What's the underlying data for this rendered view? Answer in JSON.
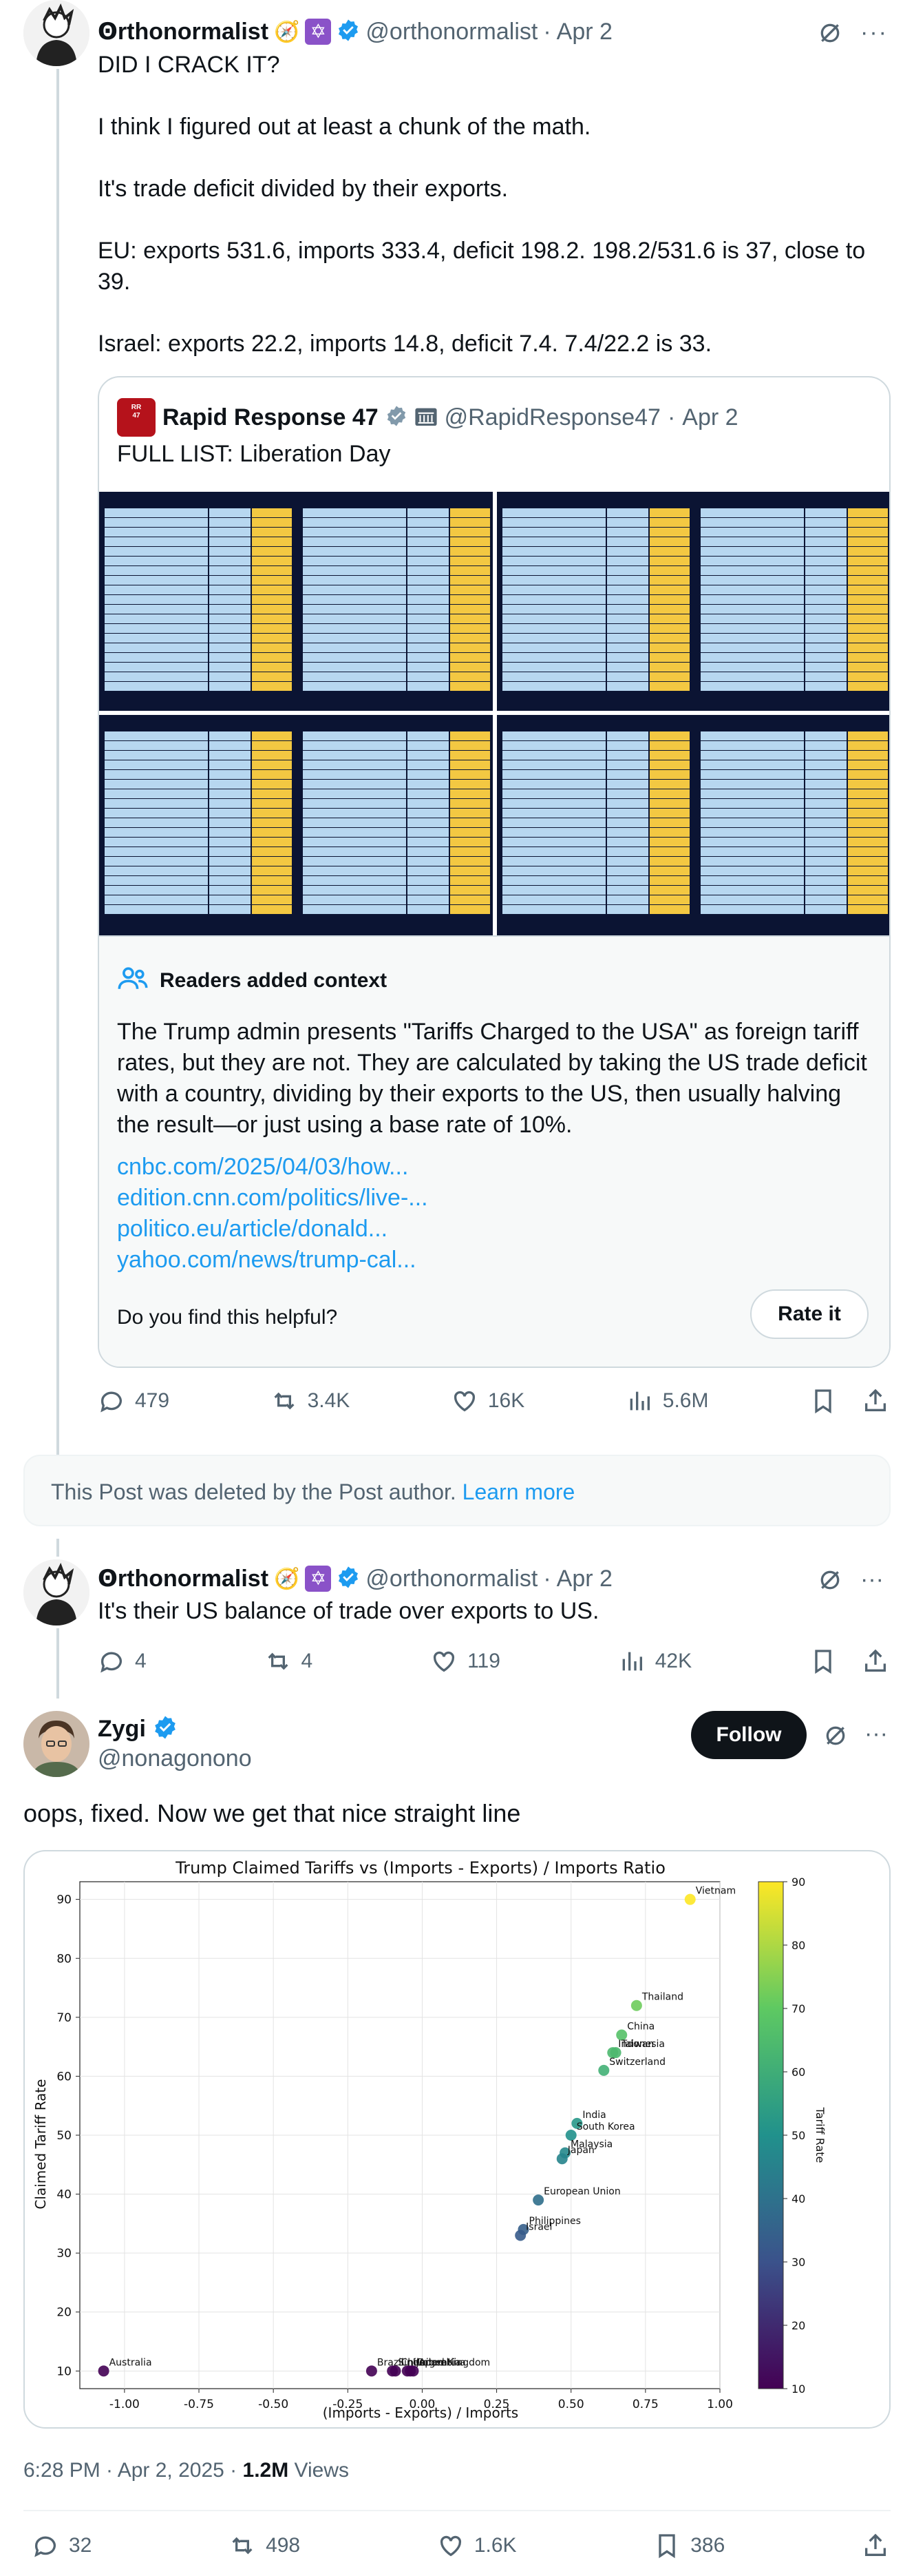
{
  "tweet1": {
    "display_name": "Ꙩrthonormalist",
    "handle": "@orthonormalist",
    "date": "Apr 2",
    "body": "DID I CRACK IT?\n\nI think I figured out at least a chunk of the math.\n\nIt's trade deficit divided by their exports.\n\nEU: exports 531.6, imports 333.4, deficit 198.2. 198.2/531.6 is 37, close to 39.\n\nIsrael: exports 22.2, imports 14.8, deficit 7.4. 7.4/22.2 is 33.",
    "quote": {
      "display_name": "Rapid Response 47",
      "handle": "@RapidResponse47",
      "date": "Apr 2",
      "text": "FULL LIST: Liberation Day"
    },
    "community_note": {
      "title": "Readers added context",
      "text": "The Trump admin presents \"Tariffs Charged to the USA\" as foreign tariff rates, but they are not. They are calculated by taking the US trade deficit with a country, dividing by their exports to the US, then usually halving the result—or just using a base rate of 10%.",
      "links": [
        "cnbc.com/2025/04/03/how...",
        "edition.cnn.com/politics/live-...",
        "politico.eu/article/donald...",
        "yahoo.com/news/trump-cal..."
      ],
      "question": "Do you find this helpful?",
      "rate_label": "Rate it"
    },
    "stats": {
      "replies": "479",
      "reposts": "3.4K",
      "likes": "16K",
      "views": "5.6M"
    }
  },
  "deleted_notice": {
    "text": "This Post was deleted by the Post author.",
    "link": "Learn more"
  },
  "tweet2": {
    "display_name": "Ꙩrthonormalist",
    "handle": "@orthonormalist",
    "date": "Apr 2",
    "body": "It's their US balance of trade over exports to US.",
    "stats": {
      "replies": "4",
      "reposts": "4",
      "likes": "119",
      "views": "42K"
    }
  },
  "main_tweet": {
    "display_name": "Zygi",
    "handle": "@nonagonono",
    "follow_label": "Follow",
    "body": "oops, fixed. Now we get that nice straight line",
    "timestamp": "6:28 PM · Apr 2, 2025 · ",
    "views_count": "1.2M",
    "views_label": " Views",
    "stats": {
      "replies": "32",
      "reposts": "498",
      "likes": "1.6K",
      "bookmarks": "386"
    }
  },
  "chart_data": {
    "type": "scatter",
    "title": "Trump Claimed Tariffs vs (Imports - Exports) / Imports Ratio",
    "xlabel": "(Imports - Exports) / Imports",
    "ylabel": "Claimed Tariff Rate",
    "colorbar_label": "Tariff Rate",
    "xlim": [
      -1.15,
      1.0
    ],
    "ylim": [
      7,
      93
    ],
    "xticks": [
      "-1.00",
      "-0.75",
      "-0.50",
      "-0.25",
      "0.00",
      "0.25",
      "0.50",
      "0.75",
      "1.00"
    ],
    "xtick_values": [
      -1.0,
      -0.75,
      -0.5,
      -0.25,
      0.0,
      0.25,
      0.5,
      0.75,
      1.0
    ],
    "yticks": [
      "10",
      "20",
      "30",
      "40",
      "50",
      "60",
      "70",
      "80",
      "90"
    ],
    "ytick_values": [
      10,
      20,
      30,
      40,
      50,
      60,
      70,
      80,
      90
    ],
    "colorbar_ticks": [
      "10",
      "20",
      "30",
      "40",
      "50",
      "60",
      "70",
      "80",
      "90"
    ],
    "color_range": [
      10,
      90
    ],
    "grid": true,
    "points": [
      {
        "label": "Vietnam",
        "x": 0.9,
        "y": 90
      },
      {
        "label": "Thailand",
        "x": 0.72,
        "y": 72
      },
      {
        "label": "China",
        "x": 0.67,
        "y": 67
      },
      {
        "label": "Taiwan",
        "x": 0.65,
        "y": 64
      },
      {
        "label": "Indonesia",
        "x": 0.64,
        "y": 64
      },
      {
        "label": "Switzerland",
        "x": 0.61,
        "y": 61
      },
      {
        "label": "India",
        "x": 0.52,
        "y": 52
      },
      {
        "label": "South Korea",
        "x": 0.5,
        "y": 50
      },
      {
        "label": "Malaysia",
        "x": 0.48,
        "y": 47
      },
      {
        "label": "Japan",
        "x": 0.47,
        "y": 46
      },
      {
        "label": "European Union",
        "x": 0.39,
        "y": 39
      },
      {
        "label": "Philippines",
        "x": 0.34,
        "y": 34
      },
      {
        "label": "Israel",
        "x": 0.33,
        "y": 33
      },
      {
        "label": "Australia",
        "x": -1.07,
        "y": 10
      },
      {
        "label": "Brazil",
        "x": -0.17,
        "y": 10
      },
      {
        "label": "Singapore",
        "x": -0.1,
        "y": 10
      },
      {
        "label": "Chile",
        "x": -0.09,
        "y": 10
      },
      {
        "label": "United Kingdom",
        "x": -0.05,
        "y": 10
      },
      {
        "label": "Colombia",
        "x": -0.04,
        "y": 10
      },
      {
        "label": "Argentina",
        "x": -0.03,
        "y": 10
      }
    ]
  }
}
